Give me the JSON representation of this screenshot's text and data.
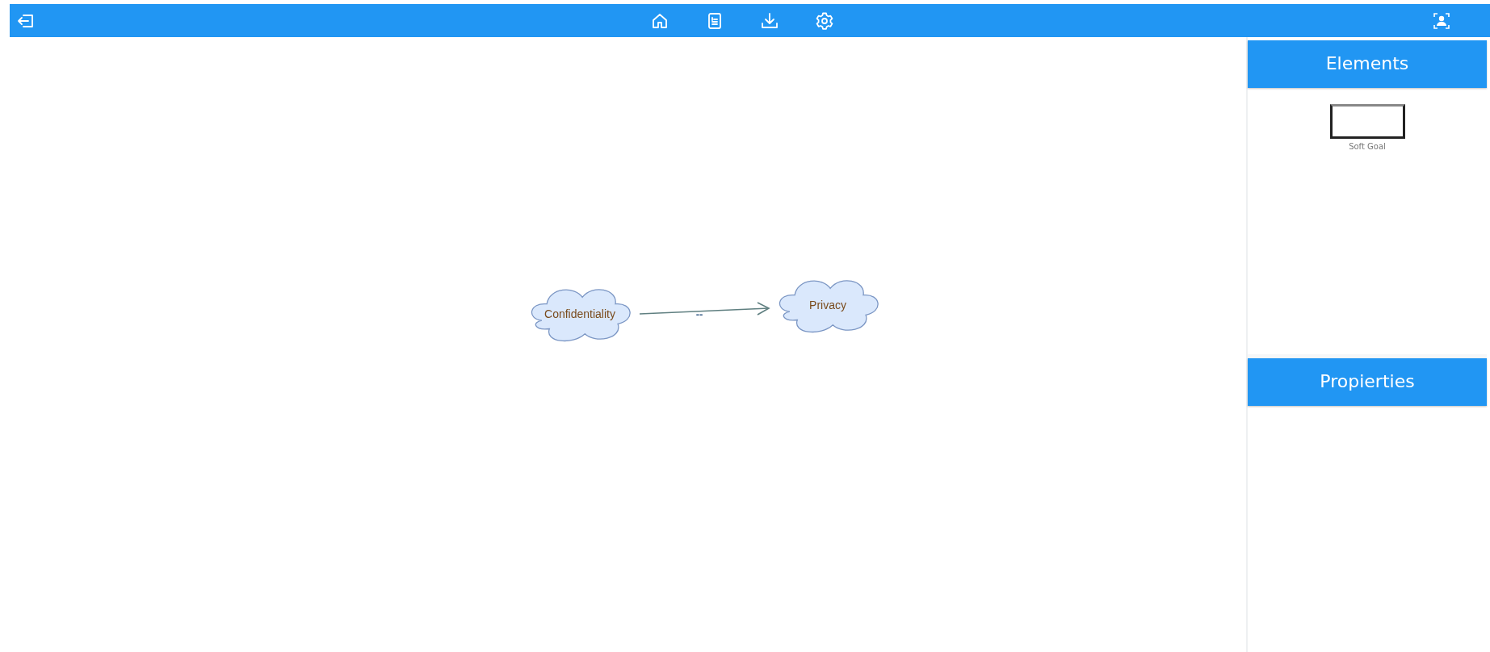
{
  "diagram": {
    "nodes": [
      {
        "kind": "softgoal",
        "label": "Confidentiality"
      },
      {
        "kind": "softgoal",
        "label": "Privacy"
      }
    ],
    "links": [
      {
        "label": "--"
      }
    ]
  },
  "elements_panel": {
    "title": "Elements",
    "items": [
      {
        "kind": "softgoal",
        "label": "Soft Goal"
      }
    ]
  },
  "properties_panel": {
    "title": "Propierties"
  }
}
